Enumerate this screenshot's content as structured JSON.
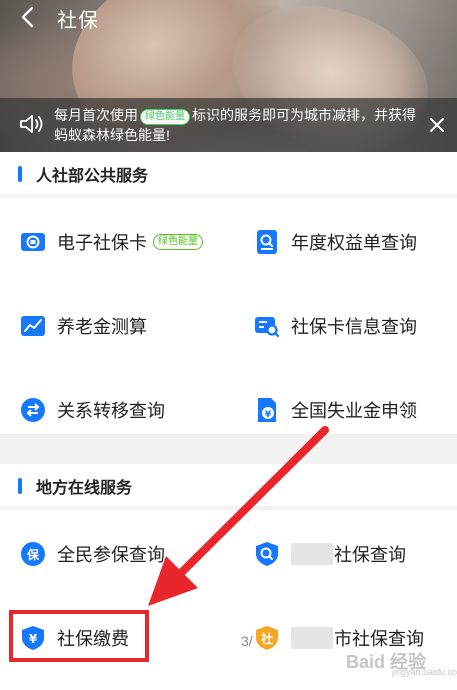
{
  "header": {
    "title": "社保"
  },
  "notice": {
    "text_before": "每月首次使用",
    "badge": "绿色能量",
    "text_after": "标识的服务即可为城市减排，并获得蚂蚁森林绿色能量!"
  },
  "section1": {
    "title": "人社部公共服务",
    "items": [
      {
        "label": "电子社保卡",
        "tag": "绿色能量",
        "icon": "social-card-icon"
      },
      {
        "label": "年度权益单查询",
        "icon": "document-search-icon"
      },
      {
        "label": "养老金测算",
        "icon": "chart-line-icon"
      },
      {
        "label": "社保卡信息查询",
        "icon": "card-search-icon"
      },
      {
        "label": "关系转移查询",
        "icon": "transfer-arrows-icon"
      },
      {
        "label": "全国失业金申领",
        "icon": "yuan-document-icon"
      }
    ]
  },
  "section2": {
    "title": "地方在线服务",
    "items": [
      {
        "label": "全民参保查询",
        "icon": "bao-shield-icon"
      },
      {
        "label": "社保查询",
        "icon": "search-shield-icon"
      },
      {
        "label": "社保缴费",
        "icon": "yuan-shield-icon"
      },
      {
        "label": "市社保查询",
        "icon": "she-shield-icon"
      }
    ]
  },
  "overlay": {
    "page_index": "3/",
    "watermark": "Baid 经验",
    "watermark_sub": "jingyan.baidu.com"
  },
  "colors": {
    "accent": "#1677ff",
    "highlight": "#e8262b",
    "green": "#52c41a"
  }
}
